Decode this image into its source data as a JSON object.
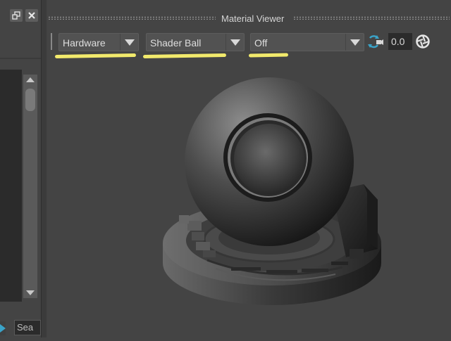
{
  "left_panel": {
    "search": {
      "text": "Sea"
    }
  },
  "material_viewer": {
    "title": "Material Viewer",
    "toolbar": {
      "renderer": {
        "selected": "Hardware"
      },
      "geometry": {
        "selected": "Shader Ball"
      },
      "environment": {
        "selected": "Off"
      },
      "exposure_value": "0.0",
      "icons": [
        "refresh-camera-icon",
        "pause-icon",
        "aperture-icon"
      ]
    }
  },
  "colors": {
    "panel_bg": "#444444",
    "dropdown_bg": "#525252",
    "highlight": "#f2ea6c",
    "refresh_accent": "#3aa3c8"
  }
}
